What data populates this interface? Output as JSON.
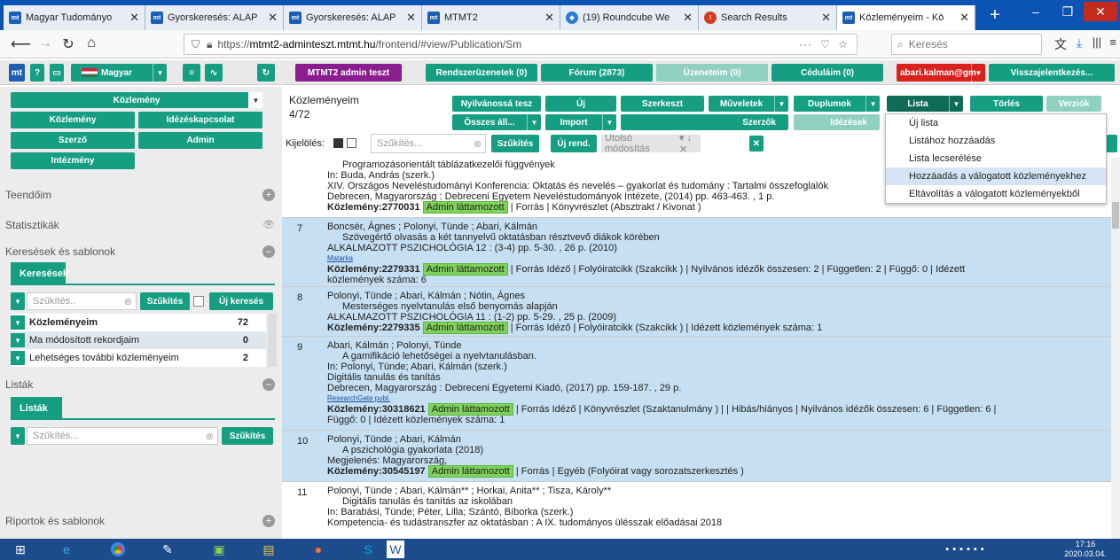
{
  "browser": {
    "tabs": [
      {
        "label": "Magyar Tudományo",
        "icon": "mtmt-icon"
      },
      {
        "label": "Gyorskeresés: ALAP",
        "icon": "mtmt-icon"
      },
      {
        "label": "Gyorskeresés: ALAP",
        "icon": "mtmt-icon"
      },
      {
        "label": "MTMT2",
        "icon": "mtmt-icon"
      },
      {
        "label": "(19) Roundcube We",
        "icon": "roundcube-icon"
      },
      {
        "label": "Search Results",
        "icon": "search-results-icon"
      },
      {
        "label": "Közleményeim - Kö",
        "icon": "mtmt-icon"
      }
    ],
    "url_prefix": "https://",
    "url_domain": "mtmt2-adminteszt.mtmt.hu",
    "url_path": "/frontend/#view/Publication/Sm",
    "search_placeholder": "Keresés",
    "colors": {
      "tabbar": "#0c54b3",
      "accent_green": "#169e82",
      "selected_row": "#c6dff2"
    }
  },
  "header": {
    "language": "Magyar",
    "admin_test": "MTMT2 admin teszt",
    "system_messages": "Rendszerüzenetek (0)",
    "forum": "Fórum (2873)",
    "my_messages": "Üzeneteim (0)",
    "notes": "Céduláim (0)",
    "user": "abari.kalman@gm",
    "feedback": "Visszajelentkezés..."
  },
  "sidebar": {
    "type_select": "Közlemény",
    "buttons": [
      "Közlemény",
      "Idézéskapcsolat",
      "Szerző",
      "Admin",
      "Intézmény"
    ],
    "sections": {
      "todo": "Teendőim",
      "stats": "Statisztikák",
      "searches": "Keresések és sablonok",
      "lists": "Listák",
      "reports": "Riportok és sablonok"
    },
    "searches_tab": "Keresések",
    "lists_tab": "Listák",
    "filter_placeholder": "Szűkítés..",
    "filter_btn": "Szűkítés",
    "new_search_btn": "Új keresés",
    "saved": [
      {
        "label": "Közleményeim",
        "count": "72"
      },
      {
        "label": "Ma módosított rekordjaim",
        "count": "0"
      },
      {
        "label": "Lehetséges további közleményeim",
        "count": "2"
      }
    ],
    "lists_filter_placeholder": "Szűkítés...",
    "lists_filter_btn": "Szűkítés"
  },
  "main": {
    "title": "Közleményeim",
    "count": "4/72",
    "buttons": {
      "publish": "Nyilvánossá tesz",
      "new": "Új",
      "edit": "Szerkeszt",
      "ops": "Műveletek",
      "dupl": "Duplumok",
      "list": "Lista",
      "delete": "Törlés",
      "versions": "Verziók",
      "all_state": "Összes áll...",
      "import": "Import",
      "authors": "Szerzők",
      "citations": "Idézések"
    },
    "selection_label": "Kijelölés:",
    "filter_placeholder": "Szűkítés...",
    "filter_btn": "Szűkítés",
    "sort_btn": "Új rend.",
    "sort_field": "Utolsó módosítás",
    "list_menu": [
      "Új lista",
      "Listához hozzáadás",
      "Lista lecserélése",
      "Hozzáadás a válogatott közleményekhez",
      "Eltávolítás a válogatott közleményekből"
    ]
  },
  "records": [
    {
      "num": "",
      "lines": [
        "Programozásorientált táblázatkezelői függvények",
        "In: Buda, András (szerk.)",
        "XIV. Országos Neveléstudományi Konferencia: Oktatás és nevelés – gyakorlat és tudomány : Tartalmi összefoglalók",
        "Debrecen, Magyarország : Debreceni Egyetem Neveléstudományok Intézete, (2014) pp. 463-463. , 1 p."
      ],
      "id": "Közlemény:2770031",
      "badge": "Admin láttamozott",
      "tail": "| Forrás | Könyvrészlet (Absztrakt / Kivonat )"
    },
    {
      "num": "7",
      "lines": [
        "Boncsér, Ágnes ; Polonyi, Tünde ; Abari, Kálmán",
        "Szövegértő olvasás a két tannyelvű oktatásban résztvevő diákok körében",
        "ALKALMAZOTT PSZICHOLÓGIA 12 : (3-4) pp. 5-30. , 26 p. (2010)"
      ],
      "link": "Matarka",
      "id": "Közlemény:2279331",
      "badge": "Admin láttamozott",
      "tail": "| Forrás Idéző | Folyóiratcikk (Szakcikk ) | Nyilvános idézők összesen: 2 | Független: 2 | Függő: 0 | Idézett",
      "tail2": "közlemények száma: 6"
    },
    {
      "num": "8",
      "lines": [
        "Polonyi, Tünde ; Abari, Kálmán ; Nótin, Ágnes",
        "Mesterséges nyelvtanulás első benyomás alapján",
        "ALKALMAZOTT PSZICHOLÓGIA 11 : (1-2) pp. 5-29. , 25 p. (2009)"
      ],
      "id": "Közlemény:2279335",
      "badge": "Admin láttamozott",
      "tail": "| Forrás Idéző | Folyóiratcikk (Szakcikk ) | Idézett közlemények száma: 1"
    },
    {
      "num": "9",
      "lines": [
        "Abari, Kálmán ; Polonyi, Tünde",
        "A gamifikáció lehetőségei a nyelvtanulásban.",
        "In: Polonyi, Tünde; Abari, Kálmán (szerk.)",
        "Digitális tanulás és tanítás",
        "Debrecen, Magyarország : Debreceni Egyetemi Kiadó, (2017) pp. 159-187. , 29 p."
      ],
      "link": "ResearchGate publ.",
      "id": "Közlemény:30318621",
      "badge": "Admin láttamozott",
      "tail": "| Forrás Idéző | Könyvrészlet (Szaktanulmány ) | | Hibás/hiányos | Nyilvános idézők összesen: 6 | Független: 6 |",
      "tail2": "Függő: 0 | Idézett közlemények száma: 1"
    },
    {
      "num": "10",
      "lines": [
        "Polonyi, Tünde ; Abari, Kálmán",
        "A pszichológia gyakorlata (2018)",
        "Megjelenés: Magyarország,"
      ],
      "id": "Közlemény:30545197",
      "badge": "Admin láttamozott",
      "tail": "| Forrás | Egyéb (Folyóirat vagy sorozatszerkesztés )"
    },
    {
      "num": "11",
      "lines": [
        "Polonyi, Tünde ; Abari, Kálmán** ; Horkai, Anita** ; Tisza, Károly**",
        "Digitális tanulás és tanítás az iskolában",
        "In: Barabási, Tünde; Péter, Lilla; Szántó, Bíborka (szerk.)",
        "Kompetencia- és tudástranszfer az oktatásban : A IX. tudományos ülésszak előadásai 2018"
      ]
    }
  ],
  "taskbar": {
    "time": "17:16",
    "date": "2020.03.04."
  }
}
